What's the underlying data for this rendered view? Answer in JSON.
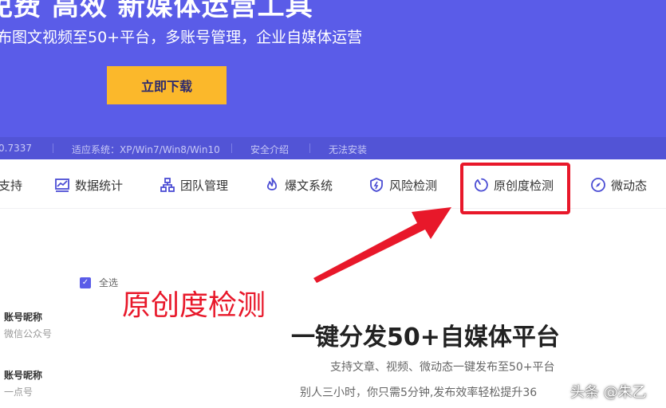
{
  "hero": {
    "title": "免费 高效 新媒体运营工具",
    "subtitle": "布图文视频至50+平台，多账号管理，企业自媒体运营",
    "download_label": "立即下载"
  },
  "infobar": {
    "version": "0.7337",
    "systems": "适应系统：XP/Win7/Win8/Win10",
    "security": "安全介绍",
    "cannot_install": "无法安装"
  },
  "nav": {
    "items": [
      {
        "label": "支持",
        "icon": "none"
      },
      {
        "label": "数据统计",
        "icon": "chart-icon"
      },
      {
        "label": "团队管理",
        "icon": "team-icon"
      },
      {
        "label": "爆文系统",
        "icon": "flame-icon"
      },
      {
        "label": "风险检测",
        "icon": "shield-icon"
      },
      {
        "label": "原创度检测",
        "icon": "circle-icon"
      },
      {
        "label": "微动态",
        "icon": "compass-icon"
      }
    ]
  },
  "annotation": {
    "text": "原创度检测",
    "color": "#e8182a"
  },
  "accounts": {
    "select_all_label": "全选",
    "items": [
      {
        "name": "账号昵称",
        "platform": "微信公众号"
      },
      {
        "name": "账号昵称",
        "platform": "一点号"
      }
    ]
  },
  "main": {
    "heading": "一键分发50+自媒体平台",
    "desc": "支持文章、视频、微动态一键发布至50+平台",
    "desc2": "别人三小时，你只需5分钟,发布效率轻松提升36"
  },
  "watermark": "头条 @朱乙",
  "colors": {
    "brand": "#5a5ce8",
    "button": "#fbb82b",
    "highlight": "#e8182a",
    "nav_icon": "#4b4dd4"
  }
}
